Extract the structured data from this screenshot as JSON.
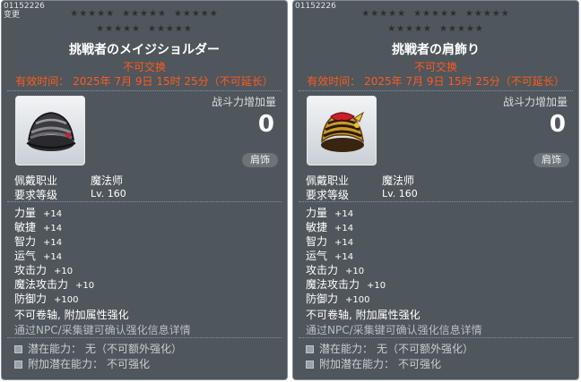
{
  "items": [
    {
      "item_id": "01152226",
      "changed_label": "变更",
      "stars_row1_groups": [
        "★★★★★",
        "★★★★★",
        "★★★★★"
      ],
      "stars_row2_groups": [
        "★★★★★",
        "★★★★★"
      ],
      "title": "挑戦者のメイジショルダー",
      "trade": "不可交换",
      "expire": "有效时间： 2025年 7月 9日 15时 25分（不可延长）",
      "icon": "black-mage-shoulder-icon",
      "cp_label": "战斗力增加量",
      "cp_value": "0",
      "slot": "肩饰",
      "job_label": "佩戴职业",
      "job_value": "魔法师",
      "level_label": "要求等级",
      "level_value": "Lv. 160",
      "stats": [
        {
          "name": "力量",
          "value": "+14"
        },
        {
          "name": "敏捷",
          "value": "+14"
        },
        {
          "name": "智力",
          "value": "+14"
        },
        {
          "name": "运气",
          "value": "+14"
        },
        {
          "name": "攻击力",
          "value": "+10"
        },
        {
          "name": "魔法攻击力",
          "value": "+10"
        },
        {
          "name": "防御力",
          "value": "+100"
        }
      ],
      "note_main": "不可卷轴, 附加属性强化",
      "note_sub": "通过NPC/采集键可确认强化信息详情",
      "potential_label": "潜在能力：",
      "potential_value": "无（不可额外强化）",
      "add_potential_label": "附加潜在能力：",
      "add_potential_value": "不可强化"
    },
    {
      "item_id": "01152226",
      "stars_row1_groups": [
        "★★★★★",
        "★★★★★",
        "★★★★★"
      ],
      "stars_row2_groups": [
        "★★★★★",
        "★★★★★"
      ],
      "title": "挑戦者の肩飾り",
      "trade": "不可交换",
      "expire": "有效时间： 2025年 7月 9日 15时 25分（不可延长）",
      "icon": "gold-red-shoulder-icon",
      "cp_label": "战斗力增加量",
      "cp_value": "0",
      "slot": "肩饰",
      "job_label": "佩戴职业",
      "job_value": "魔法师",
      "level_label": "要求等级",
      "level_value": "Lv. 160",
      "stats": [
        {
          "name": "力量",
          "value": "+14"
        },
        {
          "name": "敏捷",
          "value": "+14"
        },
        {
          "name": "智力",
          "value": "+14"
        },
        {
          "name": "运气",
          "value": "+14"
        },
        {
          "name": "攻击力",
          "value": "+10"
        },
        {
          "name": "魔法攻击力",
          "value": "+10"
        },
        {
          "name": "防御力",
          "value": "+100"
        }
      ],
      "note_main": "不可卷轴, 附加属性强化",
      "note_sub": "通过NPC/采集键可确认强化信息详情",
      "potential_label": "潜在能力：",
      "potential_value": "无（不可额外强化）",
      "add_potential_label": "附加潜在能力：",
      "add_potential_value": "不可强化"
    }
  ],
  "colors": {
    "panel_bg": "#4f565c",
    "warning_text": "#ff5a1e",
    "muted_text": "#b8bfc4"
  }
}
